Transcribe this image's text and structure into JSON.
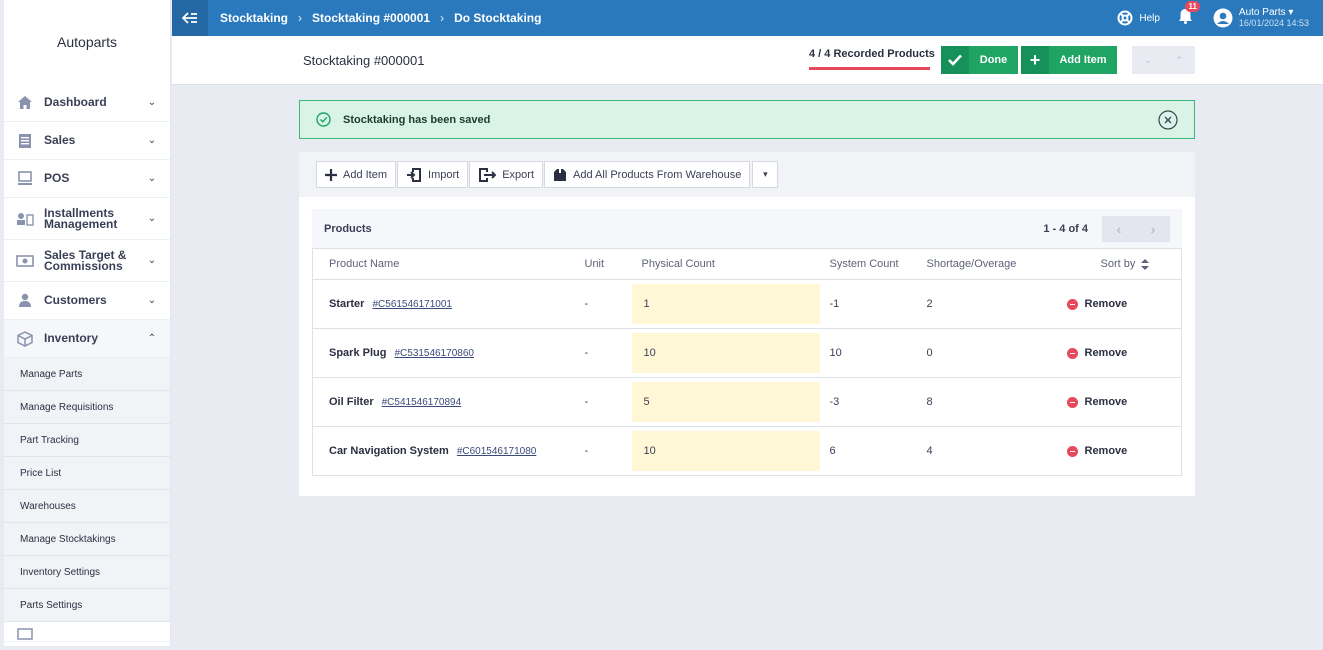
{
  "sidebar": {
    "brand": "Autoparts",
    "items": [
      {
        "label": "Dashboard",
        "icon": "home-icon"
      },
      {
        "label": "Sales",
        "icon": "document-icon"
      },
      {
        "label": "POS",
        "icon": "monitor-icon"
      },
      {
        "label": "Installments Management",
        "icon": "installments-icon"
      },
      {
        "label": "Sales Target & Commissions",
        "icon": "money-icon"
      },
      {
        "label": "Customers",
        "icon": "user-icon"
      },
      {
        "label": "Inventory",
        "icon": "box-icon"
      }
    ],
    "inventory_sub": [
      "Manage Parts",
      "Manage Requisitions",
      "Part Tracking",
      "Price List",
      "Warehouses",
      "Manage Stocktakings",
      "Inventory Settings",
      "Parts Settings"
    ]
  },
  "topbar": {
    "breadcrumbs": [
      "Stocktaking",
      "Stocktaking #000001",
      "Do Stocktaking"
    ],
    "help_label": "Help",
    "notifications_count": "11",
    "user_name": "Auto Parts",
    "user_date": "16/01/2024 14:53"
  },
  "header": {
    "title": "Stocktaking #000001",
    "recorded": "4 / 4 Recorded Products",
    "done_label": "Done",
    "add_item_label": "Add Item"
  },
  "alert": {
    "message": "Stocktaking has been saved"
  },
  "toolbar": {
    "add_item": "Add Item",
    "import": "Import",
    "export": "Export",
    "add_all": "Add All Products From Warehouse"
  },
  "products": {
    "title": "Products",
    "range": "1 - 4 of 4",
    "columns": {
      "name": "Product Name",
      "unit": "Unit",
      "physical": "Physical Count",
      "system": "System Count",
      "shortage": "Shortage/Overage",
      "sort": "Sort by"
    },
    "remove_label": "Remove",
    "rows": [
      {
        "name": "Starter",
        "code": "#C561546171001",
        "unit": "-",
        "physical": "1",
        "system": "-1",
        "shortage": "2"
      },
      {
        "name": "Spark Plug",
        "code": "#C531546170860",
        "unit": "-",
        "physical": "10",
        "system": "10",
        "shortage": "0"
      },
      {
        "name": "Oil Filter",
        "code": "#C541546170894",
        "unit": "-",
        "physical": "5",
        "system": "-3",
        "shortage": "8"
      },
      {
        "name": "Car Navigation System",
        "code": "#C601546171080",
        "unit": "-",
        "physical": "10",
        "system": "6",
        "shortage": "4"
      }
    ]
  },
  "colors": {
    "topbar": "#2a79bd",
    "success": "#1fa463",
    "danger": "#e8485b",
    "alert_bg": "#d9f3e6",
    "physical_bg": "#fff7d6"
  }
}
